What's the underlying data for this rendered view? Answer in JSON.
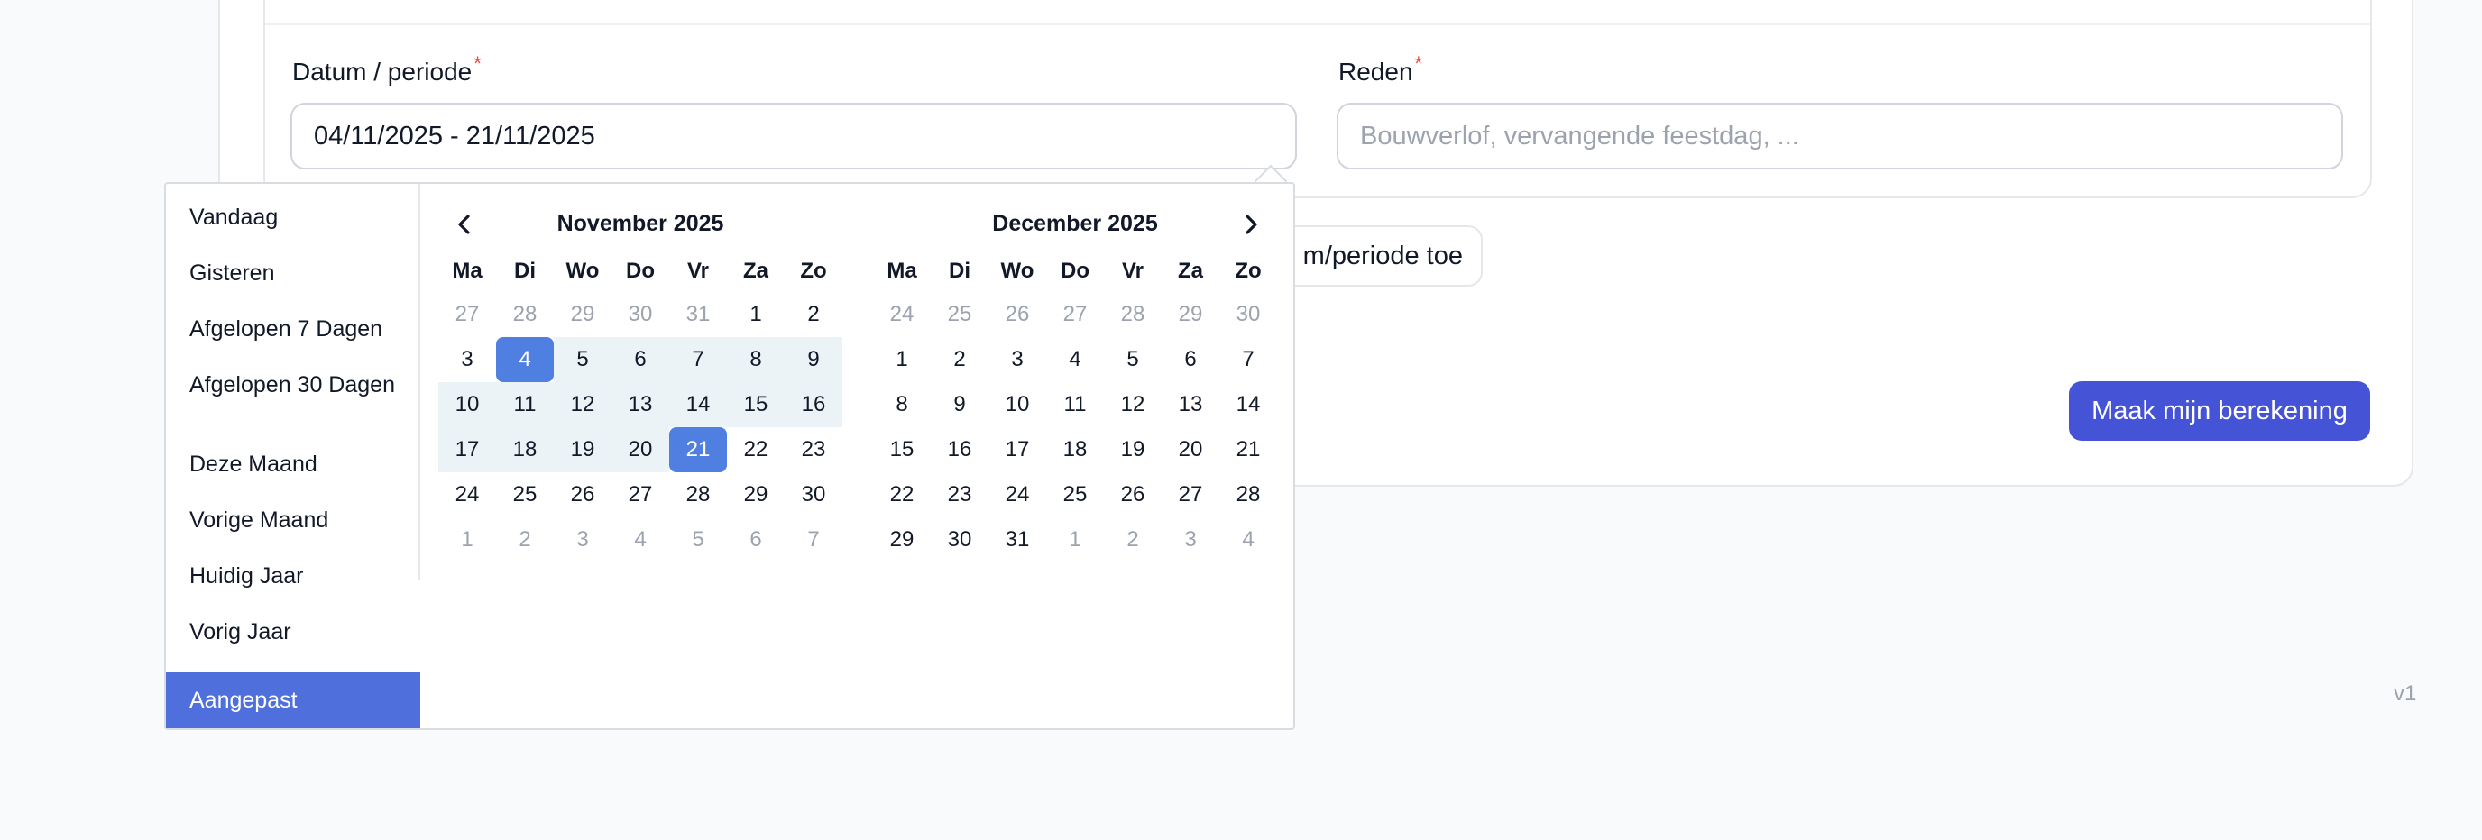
{
  "form": {
    "date_label": "Datum / periode",
    "date_required": "*",
    "date_value": "04/11/2025 - 21/11/2025",
    "reason_label": "Reden",
    "reason_required": "*",
    "reason_placeholder": "Bouwverlof, vervangende feestdag, ...",
    "add_button_label": "m/periode toe",
    "submit_button_label": "Maak mijn berekening"
  },
  "footer": {
    "version": "v1"
  },
  "picker": {
    "ranges": [
      {
        "label": "Vandaag",
        "active": false
      },
      {
        "label": "Gisteren",
        "active": false
      },
      {
        "label": "Afgelopen 7 Dagen",
        "active": false
      },
      {
        "label": "Afgelopen 30 Dagen",
        "active": false
      },
      {
        "label": "Deze Maand",
        "active": false
      },
      {
        "label": "Vorige Maand",
        "active": false
      },
      {
        "label": "Huidig Jaar",
        "active": false
      },
      {
        "label": "Vorig Jaar",
        "active": false
      },
      {
        "label": "Aangepast",
        "active": true
      }
    ],
    "weekdays": [
      "Ma",
      "Di",
      "Wo",
      "Do",
      "Vr",
      "Za",
      "Zo"
    ],
    "calendars": [
      {
        "title": "November 2025",
        "weeks": [
          [
            {
              "d": "27",
              "off": true
            },
            {
              "d": "28",
              "off": true
            },
            {
              "d": "29",
              "off": true
            },
            {
              "d": "30",
              "off": true
            },
            {
              "d": "31",
              "off": true
            },
            {
              "d": "1"
            },
            {
              "d": "2"
            }
          ],
          [
            {
              "d": "3"
            },
            {
              "d": "4",
              "state": "endpoint"
            },
            {
              "d": "5",
              "state": "inrange"
            },
            {
              "d": "6",
              "state": "inrange"
            },
            {
              "d": "7",
              "state": "inrange"
            },
            {
              "d": "8",
              "state": "inrange"
            },
            {
              "d": "9",
              "state": "inrange"
            }
          ],
          [
            {
              "d": "10",
              "state": "inrange"
            },
            {
              "d": "11",
              "state": "inrange"
            },
            {
              "d": "12",
              "state": "inrange"
            },
            {
              "d": "13",
              "state": "inrange"
            },
            {
              "d": "14",
              "state": "inrange"
            },
            {
              "d": "15",
              "state": "inrange"
            },
            {
              "d": "16",
              "state": "inrange"
            }
          ],
          [
            {
              "d": "17",
              "state": "inrange"
            },
            {
              "d": "18",
              "state": "inrange"
            },
            {
              "d": "19",
              "state": "inrange"
            },
            {
              "d": "20",
              "state": "inrange"
            },
            {
              "d": "21",
              "state": "endpoint"
            },
            {
              "d": "22"
            },
            {
              "d": "23"
            }
          ],
          [
            {
              "d": "24"
            },
            {
              "d": "25"
            },
            {
              "d": "26"
            },
            {
              "d": "27"
            },
            {
              "d": "28"
            },
            {
              "d": "29"
            },
            {
              "d": "30"
            }
          ],
          [
            {
              "d": "1",
              "off": true
            },
            {
              "d": "2",
              "off": true
            },
            {
              "d": "3",
              "off": true
            },
            {
              "d": "4",
              "off": true
            },
            {
              "d": "5",
              "off": true
            },
            {
              "d": "6",
              "off": true
            },
            {
              "d": "7",
              "off": true
            }
          ]
        ]
      },
      {
        "title": "December 2025",
        "weeks": [
          [
            {
              "d": "24",
              "off": true
            },
            {
              "d": "25",
              "off": true
            },
            {
              "d": "26",
              "off": true
            },
            {
              "d": "27",
              "off": true
            },
            {
              "d": "28",
              "off": true
            },
            {
              "d": "29",
              "off": true
            },
            {
              "d": "30",
              "off": true
            }
          ],
          [
            {
              "d": "1"
            },
            {
              "d": "2"
            },
            {
              "d": "3"
            },
            {
              "d": "4"
            },
            {
              "d": "5"
            },
            {
              "d": "6"
            },
            {
              "d": "7"
            }
          ],
          [
            {
              "d": "8"
            },
            {
              "d": "9"
            },
            {
              "d": "10"
            },
            {
              "d": "11"
            },
            {
              "d": "12"
            },
            {
              "d": "13"
            },
            {
              "d": "14"
            }
          ],
          [
            {
              "d": "15"
            },
            {
              "d": "16"
            },
            {
              "d": "17"
            },
            {
              "d": "18"
            },
            {
              "d": "19"
            },
            {
              "d": "20"
            },
            {
              "d": "21"
            }
          ],
          [
            {
              "d": "22"
            },
            {
              "d": "23"
            },
            {
              "d": "24"
            },
            {
              "d": "25"
            },
            {
              "d": "26"
            },
            {
              "d": "27"
            },
            {
              "d": "28"
            }
          ],
          [
            {
              "d": "29"
            },
            {
              "d": "30"
            },
            {
              "d": "31"
            },
            {
              "d": "1",
              "off": true
            },
            {
              "d": "2",
              "off": true
            },
            {
              "d": "3",
              "off": true
            },
            {
              "d": "4",
              "off": true
            }
          ]
        ]
      }
    ],
    "prev_icon": "chevron-left-icon",
    "next_icon": "chevron-right-icon"
  },
  "colors": {
    "accent": "#4f7fe0",
    "range_fill": "#ebf3f7",
    "active_range_item": "#4f6fdc",
    "primary_button": "#4553d6",
    "required": "#ef4444"
  }
}
